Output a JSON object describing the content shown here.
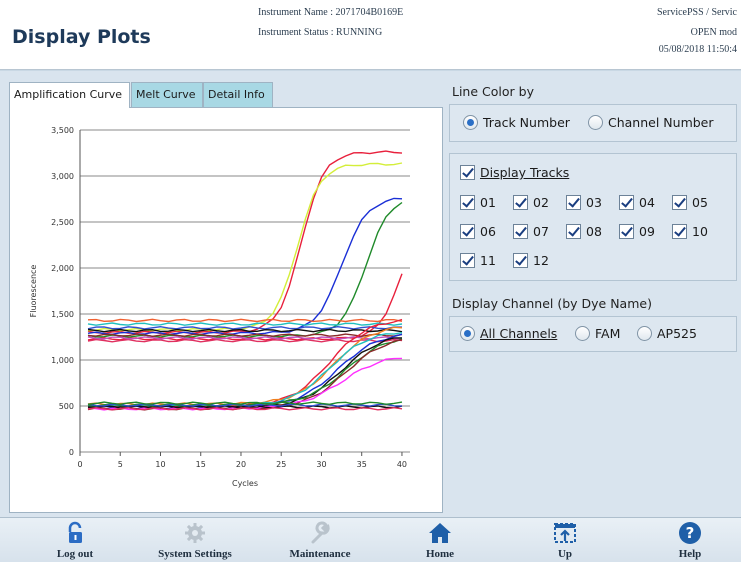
{
  "header": {
    "title": "Display Plots",
    "instrument_name": "Instrument Name :  2071704B0169E",
    "instrument_status": "Instrument Status : RUNNING",
    "user": "ServicePSS / Servic",
    "mode": "OPEN mod",
    "datetime": "05/08/2018 11:50:4"
  },
  "tabs": [
    {
      "label": "Amplification Curve",
      "active": true
    },
    {
      "label": "Melt Curve",
      "active": false
    },
    {
      "label": "Detail Info",
      "active": false
    }
  ],
  "line_color": {
    "title": "Line Color by",
    "options": [
      "Track Number",
      "Channel Number"
    ],
    "selected": "Track Number"
  },
  "display_tracks": {
    "label": "Display Tracks",
    "checked": true,
    "tracks": [
      "01",
      "02",
      "03",
      "04",
      "05",
      "06",
      "07",
      "08",
      "09",
      "10",
      "11",
      "12"
    ]
  },
  "display_channel": {
    "title": "Display Channel (by Dye Name)",
    "options": [
      "All Channels",
      "FAM",
      "AP525"
    ],
    "selected": "All Channels"
  },
  "toolbar": {
    "log_out": "Log out",
    "system_settings": "System Settings",
    "maintenance": "Maintenance",
    "home": "Home",
    "up": "Up",
    "help": "Help"
  },
  "colors": {
    "accent": "#2a6fc6",
    "tab_inactive": "#a8d8e4",
    "title": "#1e3a5a"
  },
  "chart_data": {
    "type": "line",
    "title": "",
    "xlabel": "Cycles",
    "ylabel": "Fluorescence",
    "xlim": [
      0,
      41
    ],
    "ylim": [
      0,
      3500
    ],
    "x_ticks": [
      0,
      5,
      10,
      15,
      20,
      25,
      30,
      35,
      40
    ],
    "y_ticks": [
      0,
      500,
      1000,
      1500,
      2000,
      2500,
      3000,
      3500
    ],
    "y_tick_labels": [
      "0",
      "500",
      "1,000",
      "1,500",
      "2,000",
      "2,500",
      "3,000",
      "3,500"
    ],
    "grid": true,
    "series": [
      {
        "color": "#e8203c",
        "baseline": 1300,
        "plateau": 3260,
        "ct": 27.5,
        "slope": 1.4
      },
      {
        "color": "#d4ee3a",
        "baseline": 1330,
        "plateau": 3130,
        "ct": 27.0,
        "slope": 1.4
      },
      {
        "color": "#1a2fd6",
        "baseline": 1290,
        "plateau": 2770,
        "ct": 32.5,
        "slope": 1.6
      },
      {
        "color": "#1f8a2a",
        "baseline": 1260,
        "plateau": 2790,
        "ct": 35.5,
        "slope": 1.5
      },
      {
        "color": "#e8203c",
        "baseline": 1230,
        "plateau": 2400,
        "ct": 39.5,
        "slope": 1.3
      },
      {
        "color": "#f06030",
        "baseline": 1430,
        "plateau": 1430,
        "ct": 40,
        "slope": 1
      },
      {
        "color": "#20c0c0",
        "baseline": 1390,
        "plateau": 1390,
        "ct": 40,
        "slope": 1
      },
      {
        "color": "#3050d0",
        "baseline": 1350,
        "plateau": 1350,
        "ct": 40,
        "slope": 1
      },
      {
        "color": "#101010",
        "baseline": 1320,
        "plateau": 1320,
        "ct": 40,
        "slope": 1
      },
      {
        "color": "#8a2a2a",
        "baseline": 1270,
        "plateau": 1270,
        "ct": 40,
        "slope": 1
      },
      {
        "color": "#e03060",
        "baseline": 1210,
        "plateau": 1210,
        "ct": 40,
        "slope": 1
      },
      {
        "color": "#c050c0",
        "baseline": 1240,
        "plateau": 1240,
        "ct": 40,
        "slope": 1
      },
      {
        "color": "#e8203c",
        "baseline": 500,
        "plateau": 1450,
        "ct": 31.0,
        "slope": 2.4
      },
      {
        "color": "#f08020",
        "baseline": 520,
        "plateau": 1380,
        "ct": 31.5,
        "slope": 2.4
      },
      {
        "color": "#20c0c0",
        "baseline": 500,
        "plateau": 1320,
        "ct": 31.0,
        "slope": 2.4
      },
      {
        "color": "#1a2fd6",
        "baseline": 490,
        "plateau": 1300,
        "ct": 32.0,
        "slope": 2.5
      },
      {
        "color": "#101010",
        "baseline": 480,
        "plateau": 1290,
        "ct": 32.5,
        "slope": 2.5
      },
      {
        "color": "#1f8a2a",
        "baseline": 510,
        "plateau": 1270,
        "ct": 33.0,
        "slope": 2.5
      },
      {
        "color": "#8a2a2a",
        "baseline": 470,
        "plateau": 1260,
        "ct": 33.0,
        "slope": 2.5
      },
      {
        "color": "#ff30ff",
        "baseline": 470,
        "plateau": 1060,
        "ct": 32.5,
        "slope": 2.6
      },
      {
        "color": "#101010",
        "baseline": 490,
        "plateau": 490,
        "ct": 40,
        "slope": 1
      },
      {
        "color": "#e03060",
        "baseline": 470,
        "plateau": 470,
        "ct": 40,
        "slope": 1
      },
      {
        "color": "#3050d0",
        "baseline": 510,
        "plateau": 510,
        "ct": 40,
        "slope": 1
      },
      {
        "color": "#1f8a2a",
        "baseline": 530,
        "plateau": 530,
        "ct": 40,
        "slope": 1
      }
    ]
  }
}
